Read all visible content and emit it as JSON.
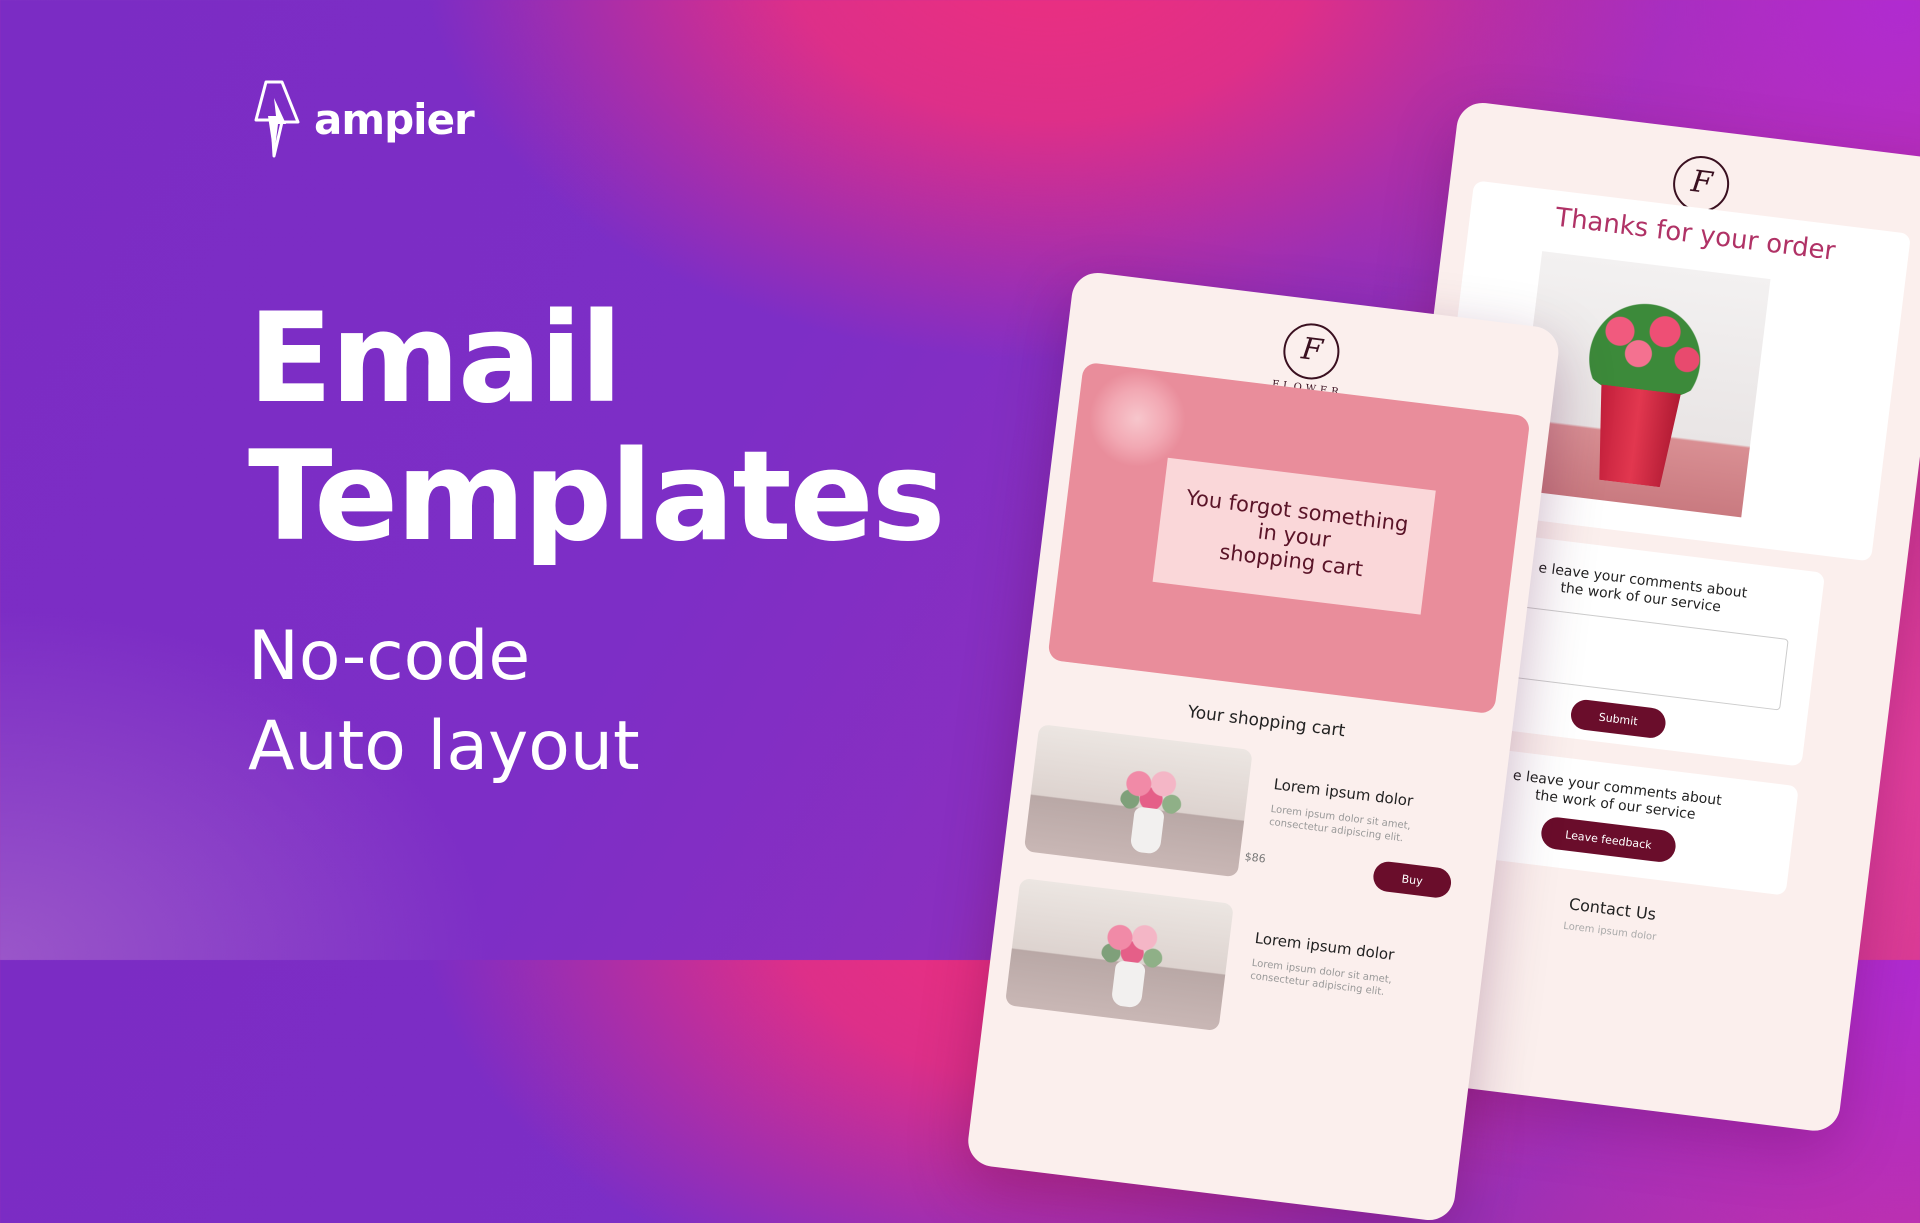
{
  "brand": {
    "name": "ampier"
  },
  "headline": {
    "line1": "Email",
    "line2": "Templates"
  },
  "subheadline": {
    "line1": "No-code",
    "line2": "Auto layout"
  },
  "flower_logo": {
    "letter": "F",
    "wordmark": "FLOWER"
  },
  "cart_email": {
    "hero_text": "You forgot something\nin your\nshopping cart",
    "section_title": "Your shopping cart",
    "items": [
      {
        "title": "Lorem ipsum dolor",
        "desc": "Lorem ipsum dolor sit amet, consectetur adipiscing elit.",
        "price": "$86",
        "button": "Buy"
      },
      {
        "title": "Lorem ipsum dolor",
        "desc": "Lorem ipsum dolor sit amet, consectetur adipiscing elit."
      }
    ]
  },
  "order_email": {
    "title": "Thanks for your order",
    "feedback1_text": "e leave your comments  about\nthe work of our service",
    "submit_label": "Submit",
    "feedback2_text": "e leave your comments  about\nthe work of our service",
    "feedback_label": "Leave feedback",
    "contact_title": "Contact Us",
    "contact_sub": "Lorem ipsum dolor"
  },
  "colors": {
    "accent": "#6a0d2b",
    "title_pink": "#b03266"
  }
}
